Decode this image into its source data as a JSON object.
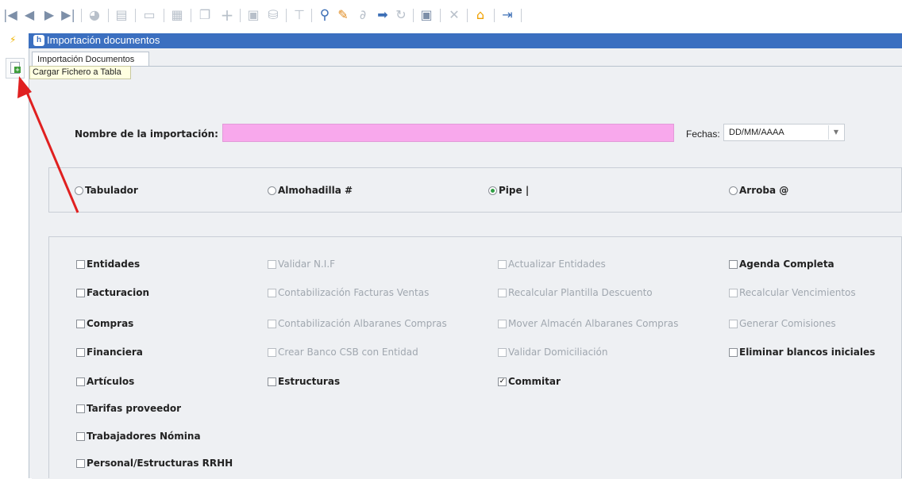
{
  "toolbar": {
    "icons": [
      "first-icon",
      "prev-icon",
      "next-icon",
      "last-icon",
      "chart-icon",
      "print-icon",
      "screen-icon",
      "grid-icon",
      "copy-icon",
      "add-icon",
      "db-icon",
      "db2-icon",
      "filter-icon",
      "search-icon",
      "edit-icon",
      "link-icon",
      "export-icon",
      "refresh-icon",
      "save-icon",
      "delete-icon",
      "home-icon",
      "exit-icon"
    ]
  },
  "window": {
    "title": "Importación documentos"
  },
  "tab": {
    "label": "Importación Documentos"
  },
  "tooltip": {
    "text": "Cargar Fichero a Tabla"
  },
  "form": {
    "name_label": "Nombre de la importación:",
    "name_value": "",
    "fechas_label": "Fechas:",
    "fechas_value": "DD/MM/AAAA"
  },
  "separators": [
    {
      "label": "Tabulador",
      "selected": false
    },
    {
      "label": "Almohadilla #",
      "selected": false
    },
    {
      "label": "Pipe |",
      "selected": true
    },
    {
      "label": "Arroba @",
      "selected": false
    }
  ],
  "options": {
    "col1": [
      {
        "label": "Entidades",
        "checked": false,
        "enabled": true
      },
      {
        "label": "Facturacion",
        "checked": false,
        "enabled": true
      },
      {
        "label": "Compras",
        "checked": false,
        "enabled": true
      },
      {
        "label": "Financiera",
        "checked": false,
        "enabled": true
      },
      {
        "label": "Artículos",
        "checked": false,
        "enabled": true
      },
      {
        "label": "Tarifas proveedor",
        "checked": false,
        "enabled": true
      },
      {
        "label": "Trabajadores Nómina",
        "checked": false,
        "enabled": true
      },
      {
        "label": "Personal/Estructuras RRHH",
        "checked": false,
        "enabled": true
      }
    ],
    "col2": [
      {
        "label": "Validar N.I.F",
        "checked": false,
        "enabled": false
      },
      {
        "label": "Contabilización Facturas  Ventas",
        "checked": false,
        "enabled": false
      },
      {
        "label": "Contabilización Albaranes  Compras",
        "checked": false,
        "enabled": false
      },
      {
        "label": "Crear Banco CSB con Entidad",
        "checked": false,
        "enabled": false
      },
      {
        "label": "Estructuras",
        "checked": false,
        "enabled": true
      }
    ],
    "col3": [
      {
        "label": "Actualizar Entidades",
        "checked": false,
        "enabled": false
      },
      {
        "label": "Recalcular Plantilla Descuento",
        "checked": false,
        "enabled": false
      },
      {
        "label": "Mover Almacén Albaranes Compras",
        "checked": false,
        "enabled": false
      },
      {
        "label": "Validar Domiciliación",
        "checked": false,
        "enabled": false
      },
      {
        "label": "Commitar",
        "checked": true,
        "enabled": true
      }
    ],
    "col4": [
      {
        "label": "Agenda Completa",
        "checked": false,
        "enabled": true
      },
      {
        "label": "Recalcular Vencimientos",
        "checked": false,
        "enabled": false
      },
      {
        "label": "Generar Comisiones",
        "checked": false,
        "enabled": false
      },
      {
        "label": "Eliminar blancos iniciales",
        "checked": false,
        "enabled": true
      }
    ]
  },
  "colors": {
    "titlebar": "#3b6fc0",
    "name_field": "#f8a8ec",
    "annotation_arrow": "#e02020"
  }
}
